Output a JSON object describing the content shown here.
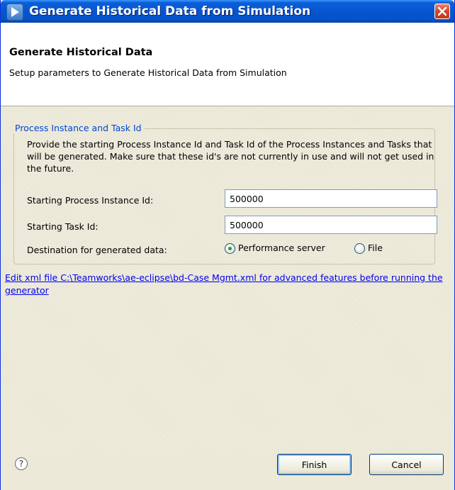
{
  "window": {
    "title": "Generate Historical Data from Simulation"
  },
  "header": {
    "title": "Generate Historical Data",
    "description": "Setup parameters to Generate Historical Data from Simulation"
  },
  "group": {
    "legend": "Process Instance and Task Id",
    "description": "Provide the starting Process Instance Id and Task Id of the Process Instances and Tasks that will be generated. Make sure that these id's are not currently in use and  will not get used in the future."
  },
  "fields": {
    "process_instance": {
      "label": "Starting Process Instance Id:",
      "value": "500000"
    },
    "task": {
      "label": "Starting Task Id:",
      "value": "500000"
    },
    "destination": {
      "label": "Destination for generated data:",
      "options": [
        {
          "label": "Performance server",
          "selected": true
        },
        {
          "label": "File",
          "selected": false
        }
      ]
    }
  },
  "link": {
    "text": "Edit xml file C:\\Teamworks\\ae-eclipse\\bd-Case Mgmt.xml for advanced features before running the generator"
  },
  "footer": {
    "help_symbol": "?",
    "finish_label": "Finish",
    "cancel_label": "Cancel"
  },
  "icons": {
    "app": "play-icon",
    "close": "close-icon",
    "help": "help-icon"
  },
  "colors": {
    "title_bar": "#0854d0",
    "close_button": "#d5452a",
    "link": "#0000ee",
    "legend": "#0046d5",
    "radio_dot": "#21a121"
  }
}
